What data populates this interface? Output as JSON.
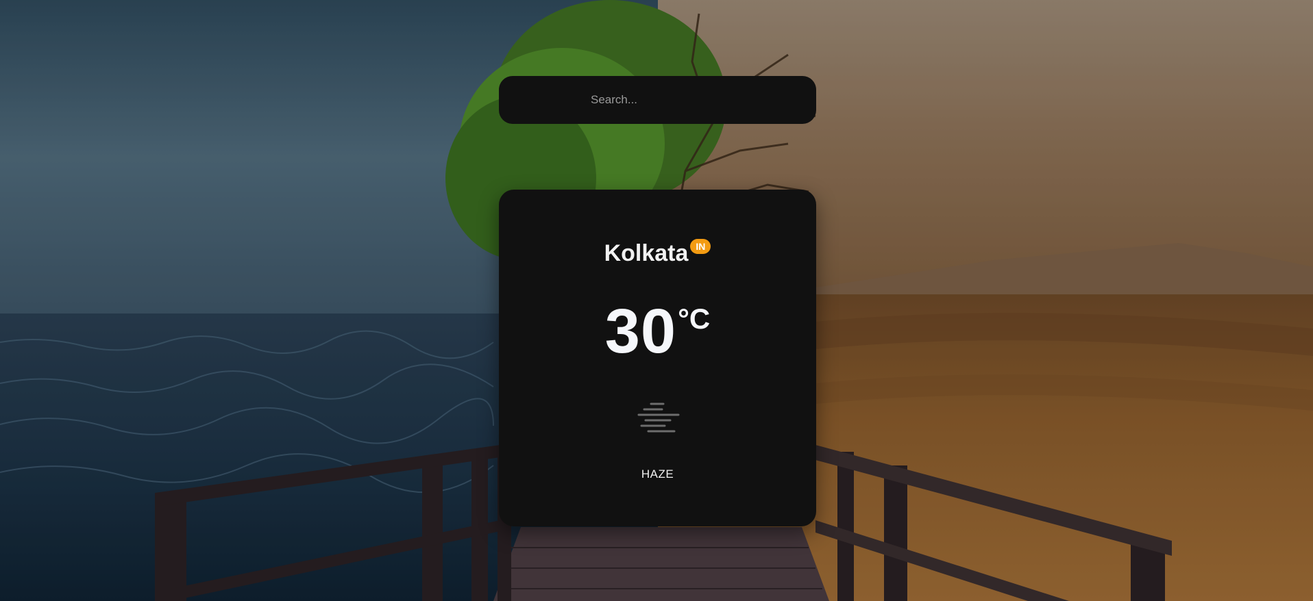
{
  "search": {
    "placeholder": "Search..."
  },
  "weather": {
    "city": "Kolkata",
    "country_code": "IN",
    "temperature": "30",
    "unit": "°C",
    "condition": "HAZE",
    "icon": "haze-icon"
  },
  "colors": {
    "card_background": "#111111",
    "badge_background": "#f39b12",
    "text": "#f2f2f2"
  }
}
